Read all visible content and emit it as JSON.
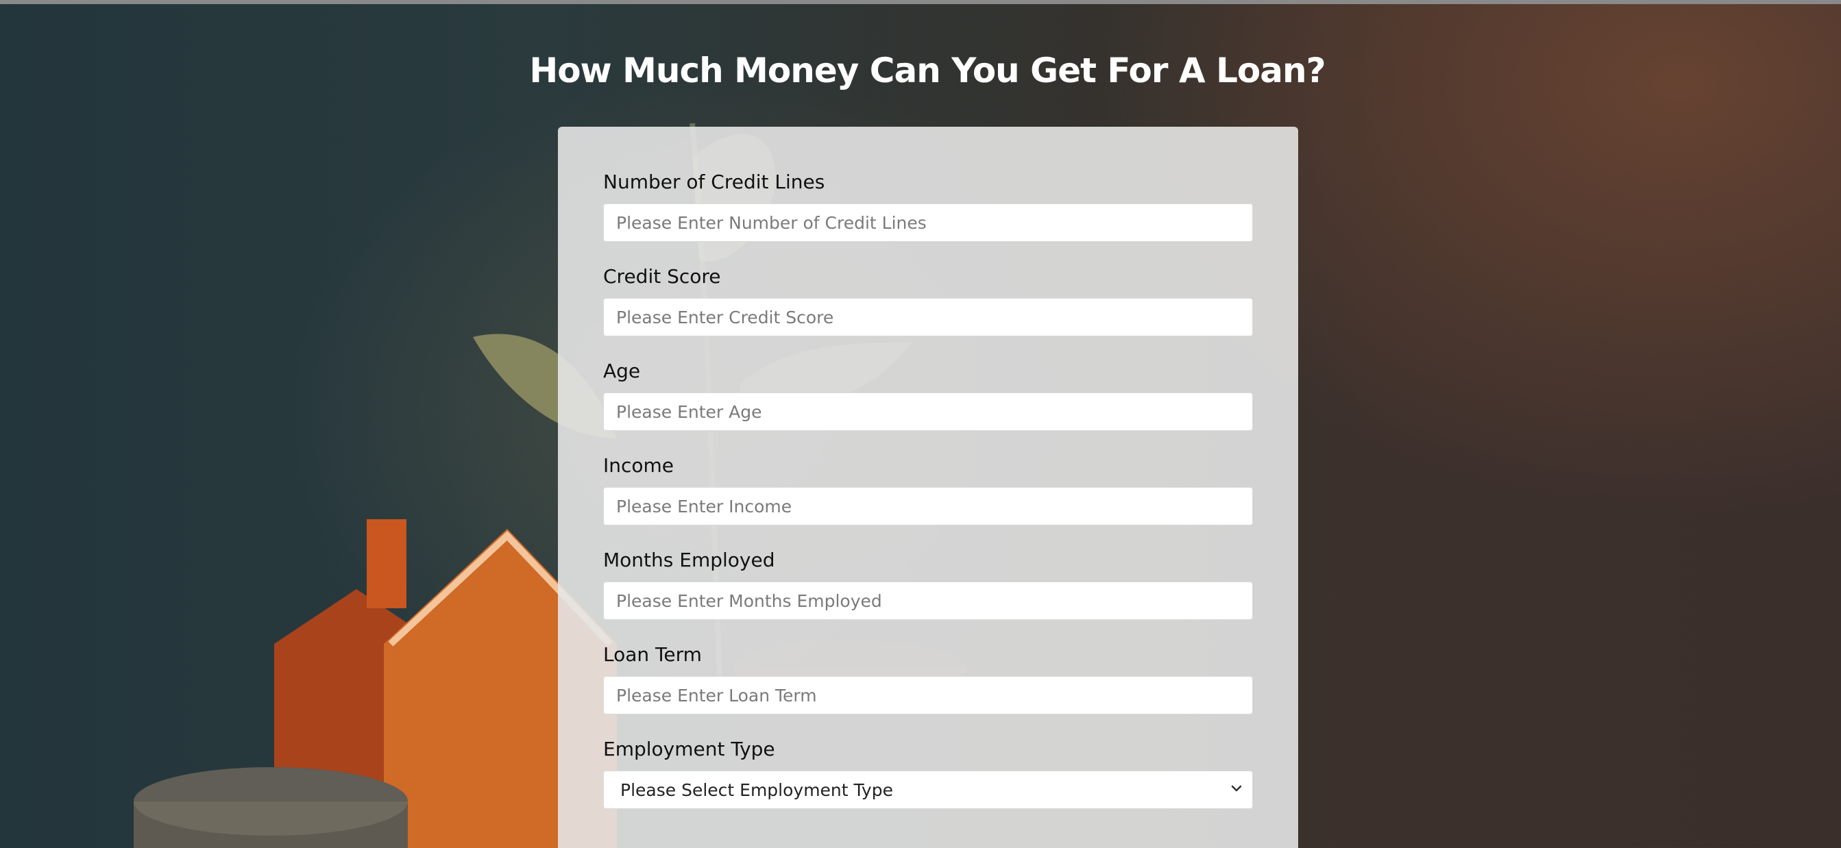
{
  "page": {
    "title": "How Much Money Can You Get For A Loan?"
  },
  "form": {
    "fields": [
      {
        "label": "Number of Credit Lines",
        "placeholder": "Please Enter Number of Credit Lines"
      },
      {
        "label": "Credit Score",
        "placeholder": "Please Enter Credit Score"
      },
      {
        "label": "Age",
        "placeholder": "Please Enter Age"
      },
      {
        "label": "Income",
        "placeholder": "Please Enter Income"
      },
      {
        "label": "Months Employed",
        "placeholder": "Please Enter Months Employed"
      },
      {
        "label": "Loan Term",
        "placeholder": "Please Enter Loan Term"
      }
    ],
    "employment": {
      "label": "Employment Type",
      "selected": "Please Select Employment Type"
    }
  },
  "icons": {
    "select_chevron": "chevron-down-icon"
  },
  "colors": {
    "title": "#ffffff",
    "card": "#e6e6e6",
    "input_bg": "#ffffff"
  }
}
